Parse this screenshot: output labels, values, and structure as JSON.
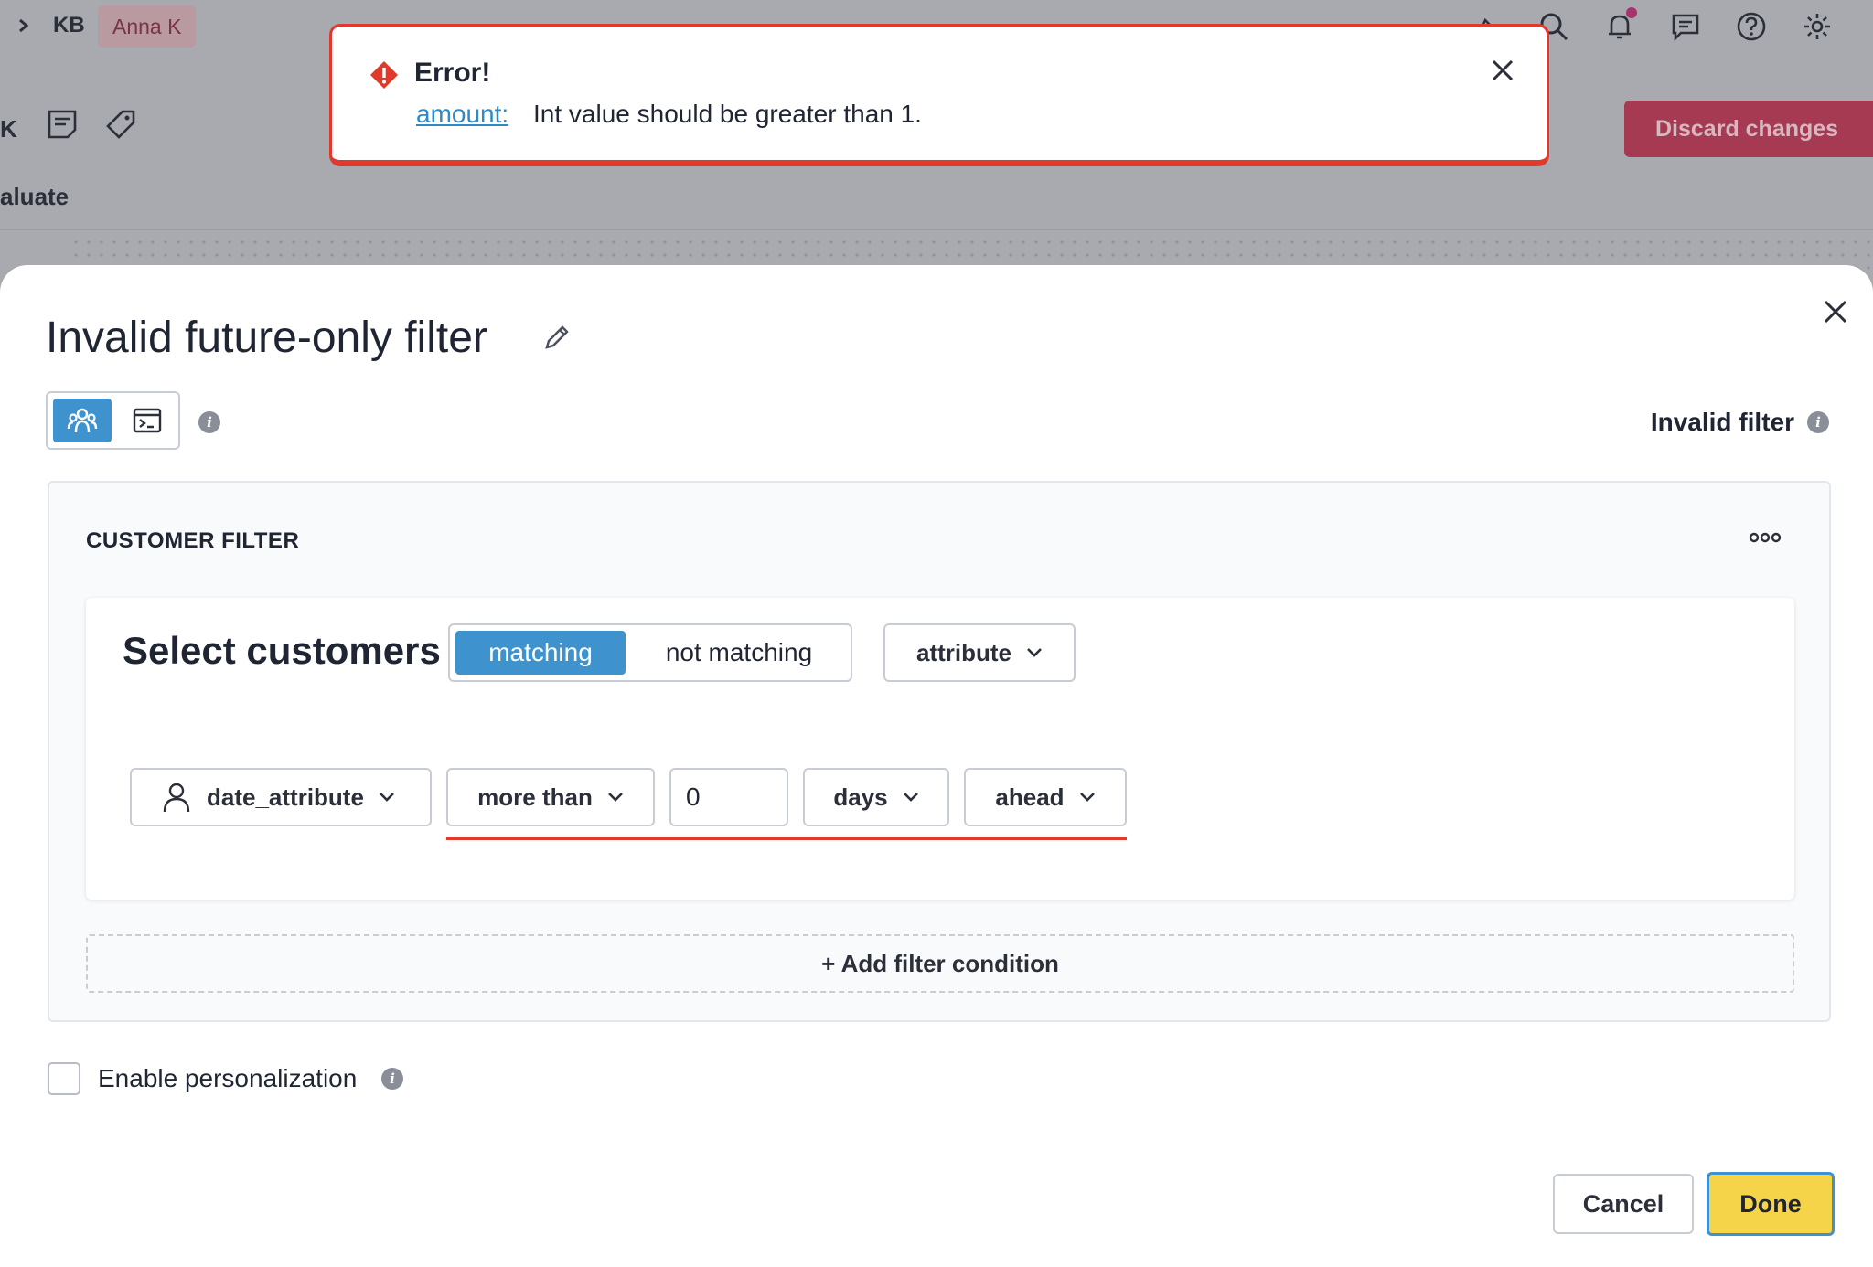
{
  "background": {
    "breadcrumb_short": "KB",
    "user_chip": "Anna K",
    "toolbar_letter": "K",
    "section_label": "aluate",
    "discard_button": "Discard changes",
    "top_icons": [
      "rocket-icon",
      "search-icon",
      "bell-icon",
      "chat-icon",
      "help-icon",
      "gear-icon"
    ]
  },
  "toast": {
    "title": "Error!",
    "field": "amount:",
    "message": "Int value should be greater than 1.",
    "border_color": "#e03a2c"
  },
  "modal": {
    "title": "Invalid future-only filter",
    "status": "Invalid filter",
    "panel_title": "CUSTOMER FILTER",
    "select_label": "Select customers",
    "match_on": "matching",
    "match_off": "not matching",
    "attribute_type": "attribute",
    "condition": {
      "attribute": "date_attribute",
      "operator": "more than",
      "amount": "0",
      "unit": "days",
      "direction": "ahead"
    },
    "add_condition": "+ Add filter condition",
    "personalization_label": "Enable personalization",
    "cancel_label": "Cancel",
    "done_label": "Done"
  },
  "colors": {
    "accent": "#3e93cf",
    "done": "#f6d44a",
    "error": "#e03a2c",
    "discard": "#a63a52"
  }
}
